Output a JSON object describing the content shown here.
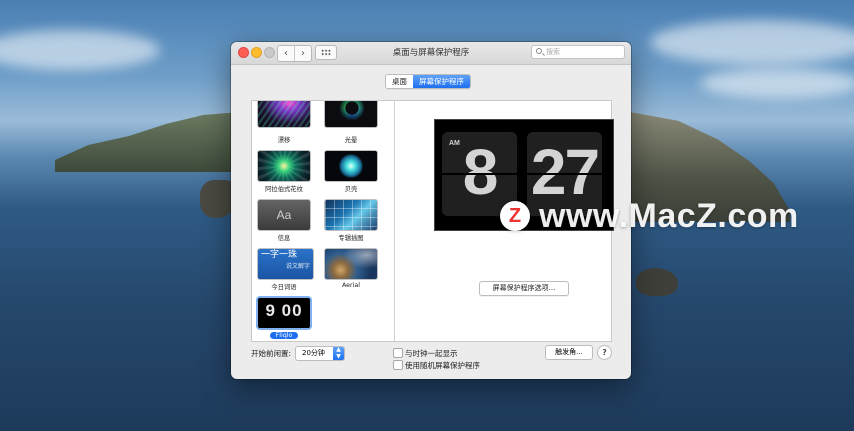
{
  "window": {
    "title": "桌面与屏幕保护程序",
    "search_placeholder": "搜索",
    "nav_back": "‹",
    "nav_forward": "›"
  },
  "tabs": [
    {
      "label": "桌面",
      "active": false
    },
    {
      "label": "屏幕保护程序",
      "active": true
    }
  ],
  "screensavers": [
    {
      "label": "漂移",
      "thumb": "drift"
    },
    {
      "label": "光晕",
      "thumb": "flurry"
    },
    {
      "label": "阿拉伯式花纹",
      "thumb": "arabesque"
    },
    {
      "label": "贝壳",
      "thumb": "shell"
    },
    {
      "label": "信息",
      "thumb": "message",
      "thumb_text": "Aa"
    },
    {
      "label": "专辑插图",
      "thumb": "album"
    },
    {
      "label": "今日词语",
      "thumb": "word",
      "thumb_text": "一字一珠",
      "thumb_subtext": "说文解字"
    },
    {
      "label": "Aerial",
      "thumb": "aerial"
    },
    {
      "label": "Fliqlo",
      "thumb": "fliqlo",
      "thumb_text": "9 00",
      "selected": true
    }
  ],
  "preview": {
    "ampm": "AM",
    "hour": "8",
    "minute": "27"
  },
  "options_button": "屏幕保护程序选项...",
  "idle": {
    "label": "开始前闲置:",
    "value": "20分钟"
  },
  "checkboxes": [
    {
      "label": "与时钟一起显示",
      "checked": false
    },
    {
      "label": "使用随机屏幕保护程序",
      "checked": false
    }
  ],
  "hot_corners_button": "触发角...",
  "help_button": "?",
  "watermark": {
    "logo_letter": "Z",
    "text": "www.MacZ.com"
  },
  "colors": {
    "accent": "#1d6ff0",
    "close": "#fd5f57",
    "minimize": "#febb2e"
  }
}
